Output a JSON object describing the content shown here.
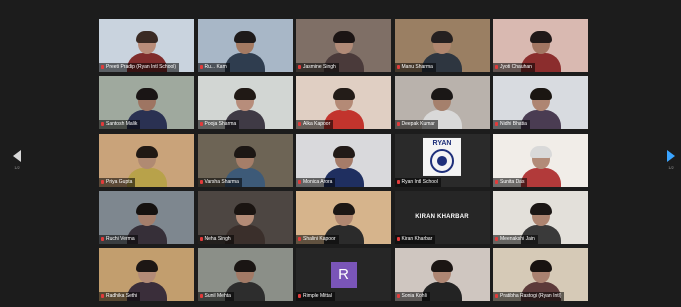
{
  "gallery": {
    "tiles": [
      {
        "name": "Preeti Pradip (Ryan Intl School)",
        "bg": "#c9d3de",
        "shirt": "#7f2c2c",
        "skin": "#b98d7a",
        "hair": "#3a2a24"
      },
      {
        "name": "Ru... Kam",
        "bg": "#a8b7c7",
        "shirt": "#2f3d4f",
        "skin": "#a47a62",
        "hair": "#1e1a1a"
      },
      {
        "name": "Jasmine Singh",
        "bg": "#7f6f66",
        "shirt": "#4a3a3a",
        "skin": "#b08a77",
        "hair": "#1b1414"
      },
      {
        "name": "Manu Sharma",
        "bg": "#9a7f63",
        "shirt": "#2e3640",
        "skin": "#b0866e",
        "hair": "#252020"
      },
      {
        "name": "Jyoti Chauhan",
        "bg": "#d9b9b1",
        "shirt": "#8b2d2d",
        "skin": "#a27562",
        "hair": "#201818"
      },
      {
        "name": "Santosh Malik",
        "bg": "#9fa99e",
        "shirt": "#2a3152",
        "skin": "#9e7562",
        "hair": "#1a1515"
      },
      {
        "name": "Pooja Sharma",
        "bg": "#d2d6d3",
        "shirt": "#3f3a45",
        "skin": "#b78d7b",
        "hair": "#201915",
        "active": true
      },
      {
        "name": "Alka Kapoor",
        "bg": "#e0cfc3",
        "shirt": "#c2342d",
        "skin": "#b48a76",
        "hair": "#231c18"
      },
      {
        "name": "Deepak Kumar",
        "bg": "#b9b2ac",
        "shirt": "#d9d9d9",
        "skin": "#a5806c",
        "hair": "#1a1716"
      },
      {
        "name": "Nidhi Bhatia",
        "bg": "#d8dbe0",
        "shirt": "#4a3c52",
        "skin": "#ae8572",
        "hair": "#1b1612"
      },
      {
        "name": "Priya Gupta",
        "bg": "#c9a37a",
        "shirt": "#b8a24a",
        "skin": "#b08a72",
        "hair": "#201914"
      },
      {
        "name": "Varsha Sharma",
        "bg": "#6d6455",
        "shirt": "#3d5a78",
        "skin": "#a57e69",
        "hair": "#1c1714"
      },
      {
        "name": "Monica Arora",
        "bg": "#d9d9dc",
        "shirt": "#1f2f60",
        "skin": "#a67c69",
        "hair": "#221a17"
      },
      {
        "name": "Ryan Intl School",
        "bg": "#2a2a2a",
        "logo": "RYAN"
      },
      {
        "name": "Sunita Das",
        "bg": "#f1ede8",
        "shirt": "#b23a3a",
        "skin": "#b28b78",
        "hair": "#d9d9d9"
      },
      {
        "name": "Ruchi Verma",
        "bg": "#7e878f",
        "shirt": "#362f38",
        "skin": "#a47e6b",
        "hair": "#15110f"
      },
      {
        "name": "Neha Singh",
        "bg": "#4d4642",
        "shirt": "#3a2f2b",
        "skin": "#b38b76",
        "hair": "#1a1411"
      },
      {
        "name": "Shalini Kapoor",
        "bg": "#d6b48c",
        "shirt": "#2b2b2b",
        "skin": "#b08770",
        "hair": "#1c1714"
      },
      {
        "name": "Kiran Kharbar",
        "text": "KIRAN KHARBAR"
      },
      {
        "name": "Meenakshi Jain",
        "bg": "#e3e0da",
        "shirt": "#3a3a3a",
        "skin": "#ad8470",
        "hair": "#1b1614"
      },
      {
        "name": "Radhika Sethi",
        "bg": "#c29e6e",
        "shirt": "#3a2e3a",
        "skin": "#b38b77",
        "hair": "#1c1614"
      },
      {
        "name": "Sunil Mehta",
        "bg": "#8b8f88",
        "shirt": "#2d2d2d",
        "skin": "#a27a66",
        "hair": "#1a1513"
      },
      {
        "name": "Rimple Mittal",
        "avatar": "R"
      },
      {
        "name": "Sonia Kohli",
        "bg": "#cfc6c0",
        "shirt": "#232323",
        "skin": "#ae8673",
        "hair": "#1b1513"
      },
      {
        "name": "Pratibha Rastogi (Ryan Intl)",
        "bg": "#d6cab7",
        "shirt": "#5c3a3a",
        "skin": "#a98170",
        "hair": "#181210"
      }
    ]
  },
  "navigation": {
    "prev_page": "1/2",
    "next_page": "1/2"
  }
}
